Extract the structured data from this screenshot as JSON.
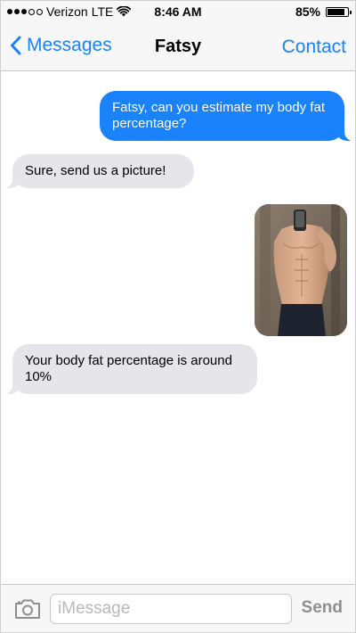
{
  "status_bar": {
    "carrier": "Verizon",
    "network": "LTE",
    "time": "8:46 AM",
    "battery_text": "85%",
    "battery_level": 0.85,
    "signal_bars_filled": 3,
    "signal_bars_total": 5
  },
  "nav": {
    "back_label": "Messages",
    "title": "Fatsy",
    "contact_label": "Contact"
  },
  "messages": [
    {
      "direction": "outgoing",
      "text": "Fatsy, can you estimate my body fat percentage?"
    },
    {
      "direction": "incoming",
      "text": "Sure, send us a picture!"
    },
    {
      "direction": "outgoing",
      "type": "photo",
      "content": "shirtless mirror selfie"
    },
    {
      "direction": "incoming",
      "text": "Your body fat percentage is around 10%"
    }
  ],
  "input_bar": {
    "placeholder": "iMessage",
    "value": "",
    "send_label": "Send"
  },
  "colors": {
    "outgoing_bubble": "#1a82fb",
    "incoming_bubble": "#e5e5ea",
    "accent": "#1a82fb"
  },
  "icons": {
    "back": "chevron-left-icon",
    "camera": "camera-icon",
    "wifi": "wifi-icon",
    "battery": "battery-icon"
  }
}
